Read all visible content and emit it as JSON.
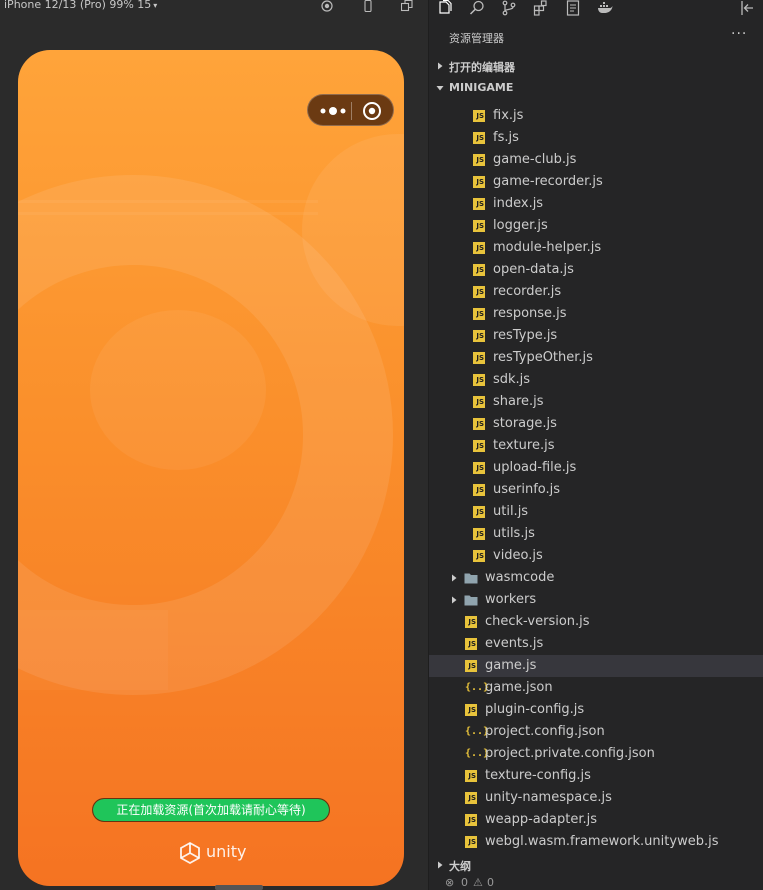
{
  "simulator": {
    "device_label": "iPhone 12/13 (Pro) 99% 15",
    "progress_text": "正在加载资源(首次加载请耐心等待)",
    "progress_percent": 100,
    "brand": "unity",
    "colors": {
      "bg_top": "#ffa43a",
      "bg_bottom": "#f57322",
      "progress_fill": "#1fc55a",
      "progress_track": "#6a3310"
    }
  },
  "explorer": {
    "title": "资源管理器",
    "more_label": "···",
    "sections": {
      "open_editors": "打开的编辑器",
      "project": "MINIGAME",
      "outline": "大纲"
    },
    "files_nested": [
      "fix.js",
      "fs.js",
      "game-club.js",
      "game-recorder.js",
      "index.js",
      "logger.js",
      "module-helper.js",
      "open-data.js",
      "recorder.js",
      "response.js",
      "resType.js",
      "resTypeOther.js",
      "sdk.js",
      "share.js",
      "storage.js",
      "texture.js",
      "upload-file.js",
      "userinfo.js",
      "util.js",
      "utils.js",
      "video.js"
    ],
    "folders": [
      "wasmcode",
      "workers"
    ],
    "root_files": [
      {
        "name": "check-version.js",
        "type": "js"
      },
      {
        "name": "events.js",
        "type": "js"
      },
      {
        "name": "game.js",
        "type": "js",
        "selected": true
      },
      {
        "name": "game.json",
        "type": "json"
      },
      {
        "name": "plugin-config.js",
        "type": "js"
      },
      {
        "name": "project.config.json",
        "type": "json"
      },
      {
        "name": "project.private.config.json",
        "type": "json"
      },
      {
        "name": "texture-config.js",
        "type": "js"
      },
      {
        "name": "unity-namespace.js",
        "type": "js"
      },
      {
        "name": "weapp-adapter.js",
        "type": "js"
      },
      {
        "name": "webgl.wasm.framework.unityweb.js",
        "type": "js"
      }
    ],
    "icon_labels": {
      "js": "JS",
      "json": "{..}"
    },
    "status": {
      "errors": "0",
      "warnings": "0"
    }
  }
}
